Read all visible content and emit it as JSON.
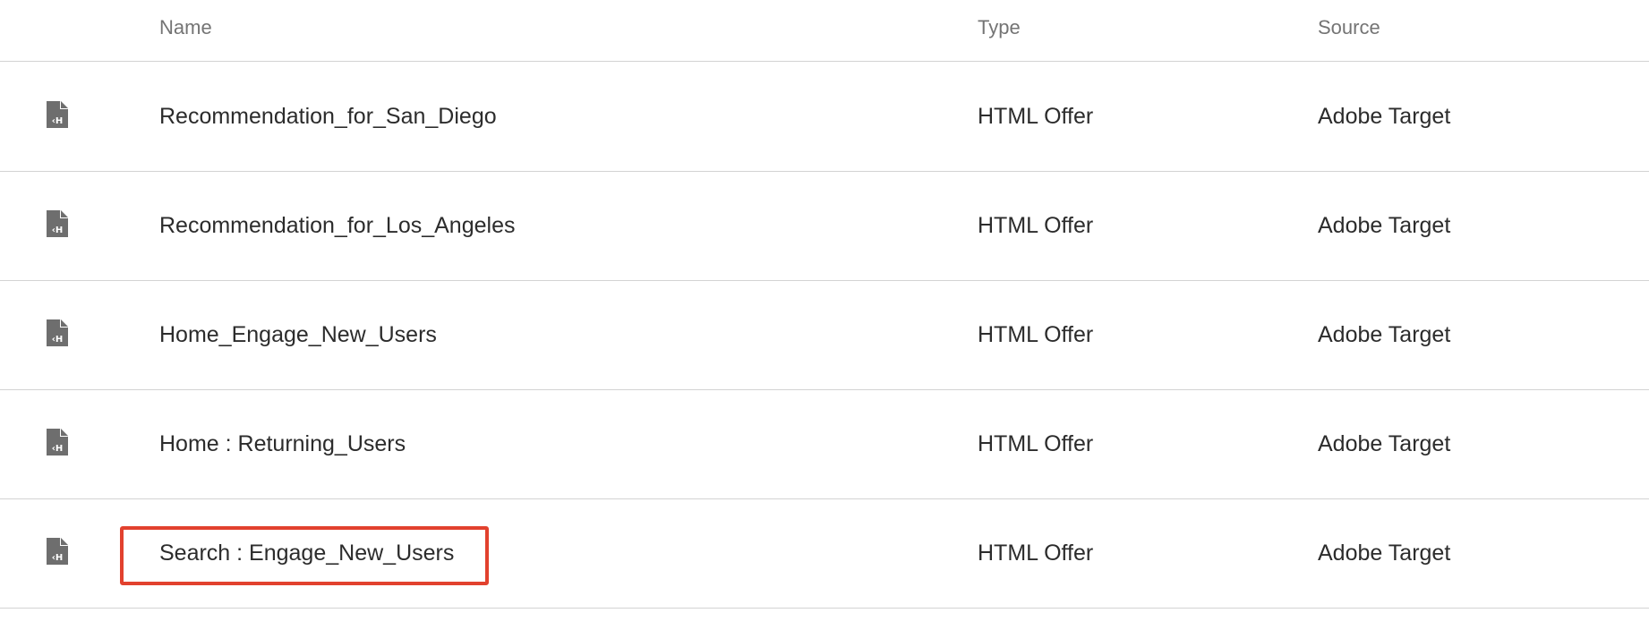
{
  "table": {
    "columns": {
      "name": "Name",
      "type": "Type",
      "source": "Source"
    },
    "rows": [
      {
        "icon": "html-offer-file-icon",
        "name": "Recommendation_for_San_Diego",
        "type": "HTML Offer",
        "source": "Adobe Target"
      },
      {
        "icon": "html-offer-file-icon",
        "name": "Recommendation_for_Los_Angeles",
        "type": "HTML Offer",
        "source": "Adobe Target"
      },
      {
        "icon": "html-offer-file-icon",
        "name": "Home_Engage_New_Users",
        "type": "HTML Offer",
        "source": "Adobe Target"
      },
      {
        "icon": "html-offer-file-icon",
        "name": "Home : Returning_Users",
        "type": "HTML Offer",
        "source": "Adobe Target"
      },
      {
        "icon": "html-offer-file-icon",
        "name": "Search : Engage_New_Users",
        "type": "HTML Offer",
        "source": "Adobe Target"
      }
    ]
  },
  "colors": {
    "highlight_border": "#e2412e",
    "divider": "#d3d3d3",
    "header_text": "#747474",
    "body_text": "#2c2c2c",
    "icon": "#6e6e6e"
  }
}
